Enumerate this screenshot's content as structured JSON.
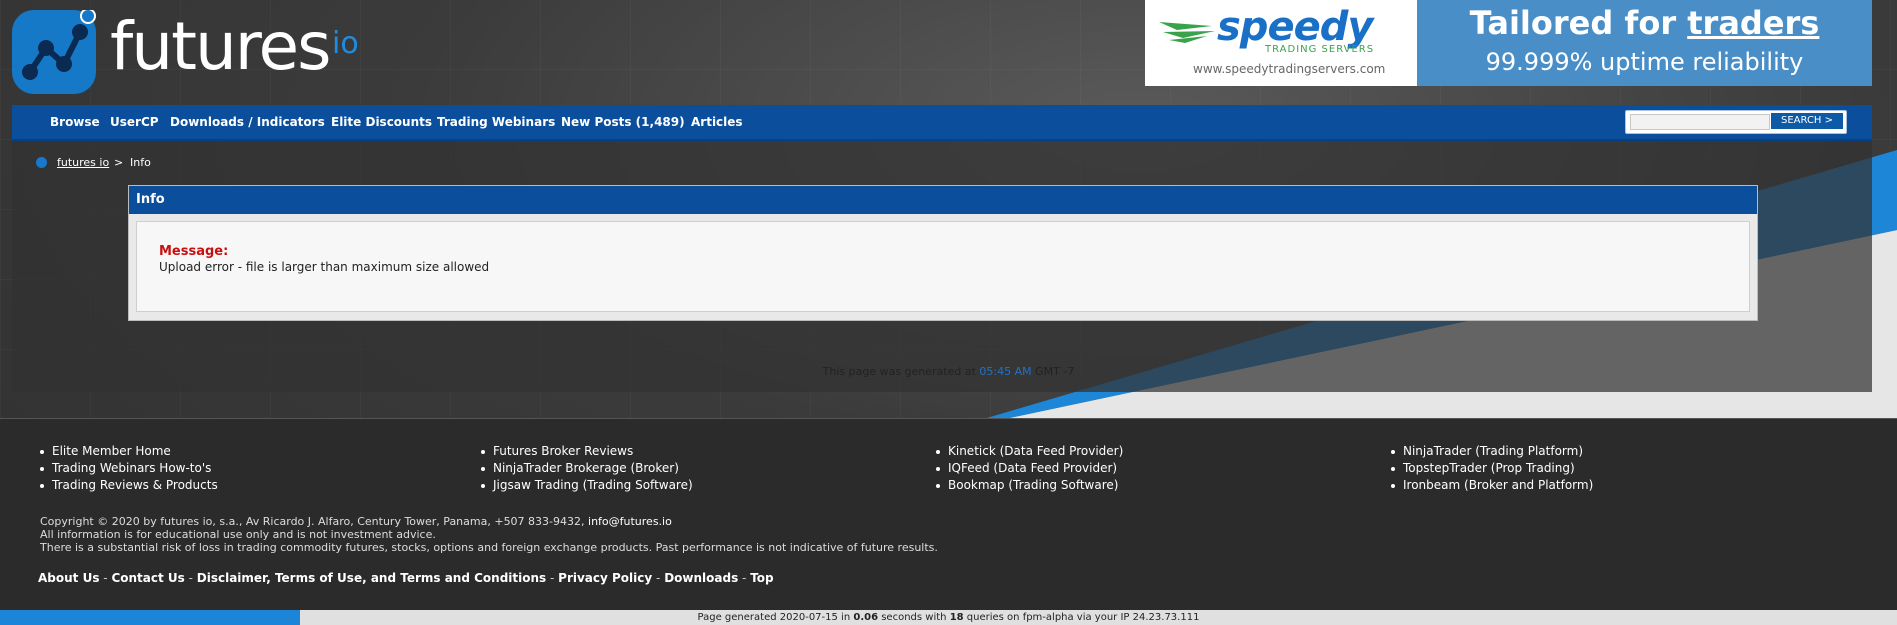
{
  "logo": {
    "text": "futures",
    "suffix": "io"
  },
  "ad": {
    "brand": "speedy",
    "brand_sub": "TRADING SERVERS",
    "url": "www.speedytradingservers.com",
    "title_a": "Tailored for ",
    "title_b": "traders",
    "subtitle": "99.999% uptime reliability"
  },
  "nav": {
    "items": [
      "Browse",
      "UserCP",
      "Downloads / Indicators",
      "Elite Discounts",
      "Trading Webinars",
      "New Posts (1,489)",
      "Articles"
    ],
    "search_button": "SEARCH  >"
  },
  "breadcrumb": {
    "home": "futures io",
    "sep": ">",
    "current": "Info"
  },
  "info": {
    "title": "Info",
    "message_label": "Message:",
    "message_text": "Upload error - file is larger than maximum size allowed"
  },
  "generated": {
    "prefix": "This page was generated at ",
    "time": "05:45 AM",
    "suffix": " GMT -7"
  },
  "footer": {
    "col1": [
      "Elite Member Home",
      "Trading Webinars How-to's",
      "Trading Reviews & Products"
    ],
    "col2": [
      "Futures Broker Reviews",
      "NinjaTrader Brokerage (Broker)",
      "Jigsaw Trading (Trading Software)"
    ],
    "col3": [
      "Kinetick (Data Feed Provider)",
      "IQFeed (Data Feed Provider)",
      "Bookmap (Trading Software)"
    ],
    "col4": [
      "NinjaTrader (Trading Platform)",
      "TopstepTrader (Prop Trading)",
      "Ironbeam (Broker and Platform)"
    ],
    "copyright_line": "Copyright © 2020 by futures io, s.a., Av Ricardo J. Alfaro, Century Tower, Panama, +507 833-9432, ",
    "email": "info@futures.io",
    "disclaimer1": "All information is for educational use only and is not investment advice.",
    "disclaimer2": "There is a substantial risk of loss in trading commodity futures, stocks, options and foreign exchange products. Past performance is not indicative of future results.",
    "links": [
      "About Us",
      "Contact Us",
      "Disclaimer, Terms of Use, and Terms and Conditions",
      "Privacy Policy",
      "Downloads",
      "Top"
    ],
    "link_sep": " - "
  },
  "bottom": {
    "p1": "Page generated 2020-07-15 in ",
    "secs": "0.06",
    "p2": " seconds with ",
    "queries": "18",
    "p3": " queries on fpm-alpha via your IP 24.23.73.111"
  },
  "colors": {
    "nav_blue": "#0b4f9c",
    "accent_blue": "#1679c8",
    "error_red": "#c81010"
  }
}
